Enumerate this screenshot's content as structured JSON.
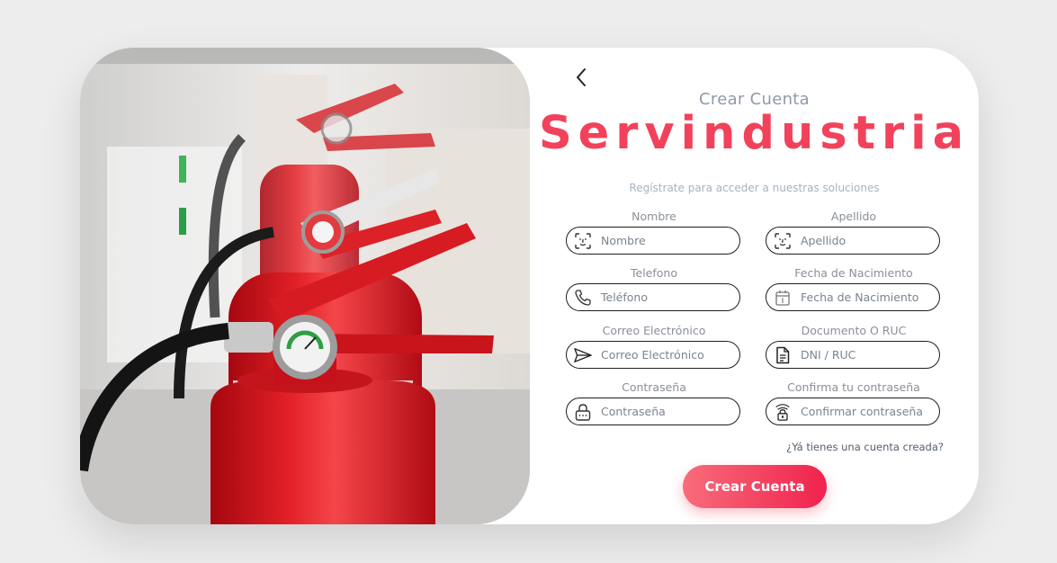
{
  "header": {
    "back_icon": "chevron-left-icon",
    "subtitle": "Crear Cuenta",
    "brand": "Servindustria",
    "tagline": "Regístrate para acceder a nuestras soluciones"
  },
  "colors": {
    "brand": "#f2425b",
    "button_start": "#f86c7b",
    "button_end": "#f0224d",
    "extinguisher_red": "#d81e24"
  },
  "image": {
    "subject": "fire-extinguishers-photo"
  },
  "form": {
    "nombre": {
      "label": "Nombre",
      "placeholder": "Nombre",
      "icon": "face-id-icon"
    },
    "apellido": {
      "label": "Apellido",
      "placeholder": "Apellido",
      "icon": "face-id-icon"
    },
    "telefono": {
      "label": "Telefono",
      "placeholder": "Teléfono",
      "icon": "phone-icon"
    },
    "fecha": {
      "label": "Fecha de Nacimiento",
      "placeholder": "Fecha de Nacimiento",
      "icon": "calendar-icon"
    },
    "correo": {
      "label": "Correo Electrónico",
      "placeholder": "Correo Electrónico",
      "icon": "send-icon"
    },
    "documento": {
      "label": "Documento O RUC",
      "placeholder": "DNI / RUC",
      "icon": "document-icon"
    },
    "password": {
      "label": "Contraseña",
      "placeholder": "Contraseña",
      "icon": "lock-icon"
    },
    "confirm": {
      "label": "Confirma tu contraseña",
      "placeholder": "Confirmar contraseña",
      "icon": "lock-wifi-icon"
    }
  },
  "login_link": "¿Yá tienes una cuenta creada?",
  "submit_label": "Crear Cuenta"
}
